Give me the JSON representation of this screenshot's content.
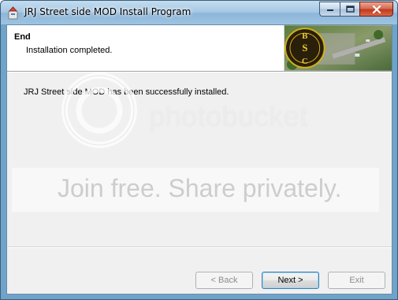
{
  "window": {
    "title": "JRJ Street side MOD Install Program"
  },
  "header": {
    "title": "End",
    "subtitle": "Installation completed.",
    "image_logo_letters": [
      "B",
      "S",
      "C"
    ]
  },
  "body": {
    "message": "JRJ Street side MOD has been successfully installed."
  },
  "buttons": {
    "back": "< Back",
    "next": "Next >",
    "exit": "Exit"
  },
  "watermark": {
    "brand": "photobucket",
    "banner": "Join free. Share privately."
  },
  "icons": {
    "app": "installer-icon",
    "minimize": "minimize-icon",
    "maximize": "maximize-icon",
    "close": "close-icon"
  }
}
